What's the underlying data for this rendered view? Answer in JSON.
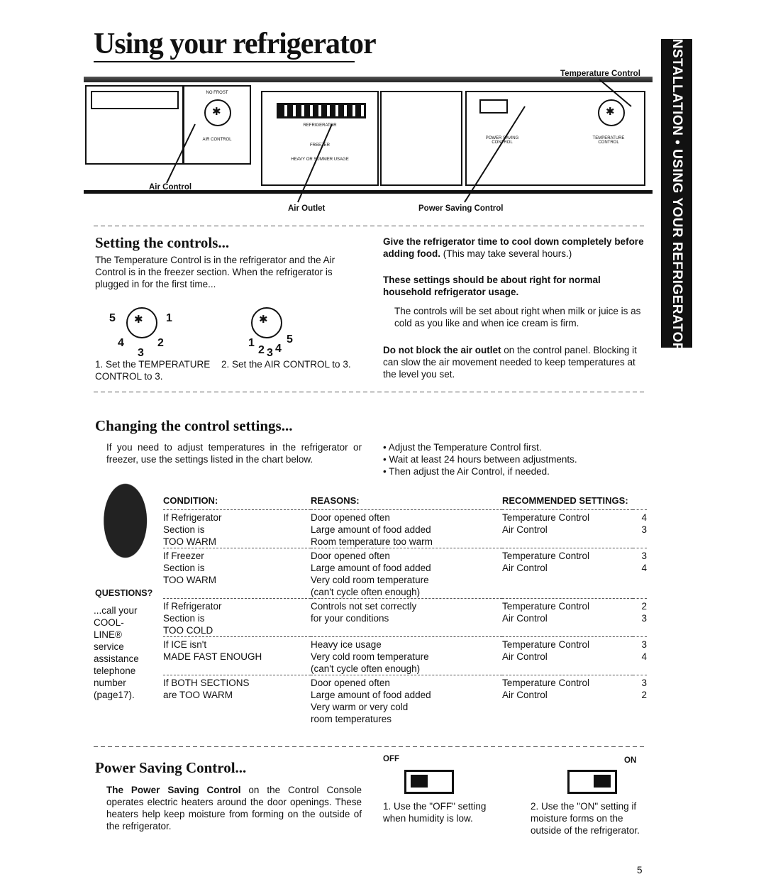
{
  "title": "Using your refrigerator",
  "side_tab": "INSTALLATION • USING YOUR REFRIGERATOR",
  "diagram": {
    "labels": {
      "temperature_control": "Temperature Control",
      "air_control": "Air Control",
      "air_outlet": "Air Outlet",
      "power_saving_control": "Power Saving Control"
    },
    "panel": {
      "no_frost": "NO FROST",
      "air_control": "AIR CONTROL",
      "refrigerator": "REFRIGERATOR",
      "freezer": "FREEZER",
      "heavy": "HEAVY OR SUMMER USAGE",
      "power_saving": "POWER SAVING CONTROL",
      "temperature": "TEMPERATURE CONTROL",
      "off": "OFF",
      "on": "ON"
    }
  },
  "setting": {
    "heading": "Setting the controls...",
    "intro": "The Temperature Control is in the refrigerator and the Air Control is in the freezer section. When the refrigerator is plugged in for the first time...",
    "dial1_numbers": [
      "5",
      "1",
      "4",
      "2",
      "3"
    ],
    "dial2_numbers": [
      "1",
      "5",
      "2",
      "3",
      "4"
    ],
    "step1": "1. Set the TEMPERATURE CONTROL to 3.",
    "step2": "2. Set the AIR CONTROL to 3.",
    "cool_down": "Give the refrigerator time to cool down completely before adding food.",
    "cool_down_note": " (This may take several hours.)",
    "settings_right": "These settings should be about right for normal household refrigerator usage.",
    "milk": "The controls will be set about right when milk or juice is as cold as you like and when ice cream is firm.",
    "outlet_bold": "Do not block the air outlet",
    "outlet_rest": " on the control panel. Blocking it can slow the air movement needed to keep temperatures at the level you set."
  },
  "changing": {
    "heading": "Changing the control settings...",
    "intro": "If you need to adjust temperatures in the refrigerator or freezer, use the settings listed in the chart below.",
    "bullets": [
      "Adjust the Temperature Control first.",
      "Wait at least 24 hours between adjustments.",
      "Then adjust the Air Control, if needed."
    ],
    "headers": {
      "condition": "CONDITION:",
      "reasons": "REASONS:",
      "recommended": "RECOMMENDED SETTINGS:"
    },
    "questions": {
      "title": "QUESTIONS?",
      "text": [
        "...call your",
        "COOL-LINE®",
        "service",
        "assistance",
        "telephone",
        "number",
        "(page17)."
      ]
    },
    "rows": [
      {
        "condition": [
          "If Refrigerator",
          "Section is",
          "TOO WARM"
        ],
        "reasons": [
          "Door opened often",
          "Large amount of food added",
          "Room temperature too warm"
        ],
        "settings": [
          [
            "Temperature Control",
            "4"
          ],
          [
            "Air Control",
            "3"
          ]
        ]
      },
      {
        "condition": [
          "If Freezer",
          "Section is",
          "TOO WARM"
        ],
        "reasons": [
          "Door opened often",
          "Large amount of food added",
          "Very cold room temperature",
          "(can't cycle often enough)"
        ],
        "settings": [
          [
            "Temperature Control",
            "3"
          ],
          [
            "Air Control",
            "4"
          ]
        ]
      },
      {
        "condition": [
          "If Refrigerator",
          "Section is",
          "TOO COLD"
        ],
        "reasons": [
          "Controls not set correctly",
          "for your conditions"
        ],
        "settings": [
          [
            "Temperature Control",
            "2"
          ],
          [
            "Air Control",
            "3"
          ]
        ]
      },
      {
        "condition": [
          "If ICE isn't",
          "MADE FAST ENOUGH"
        ],
        "reasons": [
          "Heavy ice usage",
          "Very cold room temperature",
          "(can't cycle often enough)"
        ],
        "settings": [
          [
            "Temperature Control",
            "3"
          ],
          [
            "Air Control",
            "4"
          ]
        ]
      },
      {
        "condition": [
          "If BOTH SECTIONS",
          "are TOO WARM"
        ],
        "reasons": [
          "Door opened often",
          "Large amount of food added",
          "Very warm or very cold",
          "room temperatures"
        ],
        "settings": [
          [
            "Temperature Control",
            "3"
          ],
          [
            "Air Control",
            "2"
          ]
        ]
      }
    ]
  },
  "power": {
    "heading": "Power Saving Control...",
    "text_bold": "The Power Saving Control",
    "text_rest": " on the Control Console operates electric heaters around the door openings. These heaters help keep moisture from forming on the outside of the refrigerator.",
    "off_label": "OFF",
    "on_label": "ON",
    "step1": "1. Use the \"OFF\" setting when humidity is low.",
    "step2": "2. Use the \"ON\" setting if moisture forms on the outside of the refrigerator."
  },
  "page_number": "5"
}
